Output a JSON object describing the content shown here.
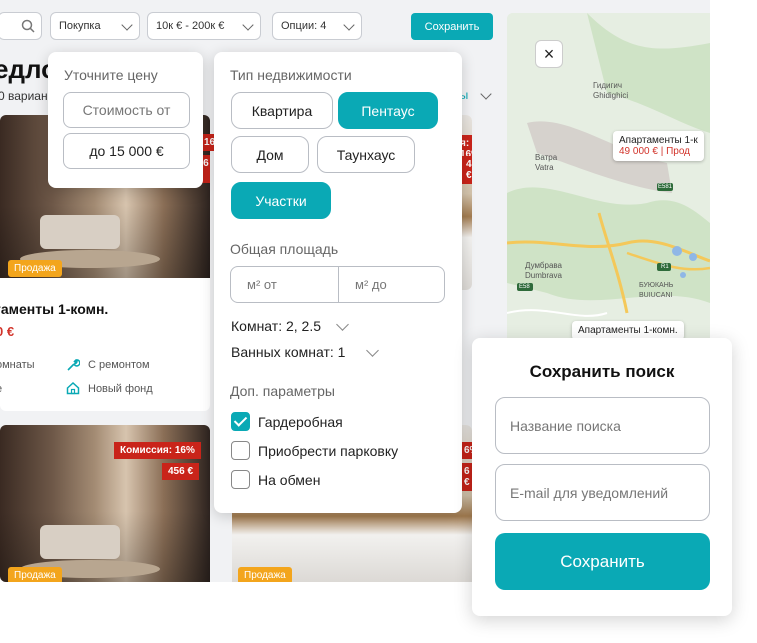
{
  "topbar": {
    "deal_type": "Покупка",
    "price_range": "10к € - 200к €",
    "options": "Опции: 4",
    "save_label": "Сохранить"
  },
  "listing": {
    "heading": "едложе",
    "count": "0 вариан",
    "sort_hint": "ны"
  },
  "cards": [
    {
      "badge": "Продажа",
      "commission": "Комиссия: 16%",
      "price_tag": "456 €",
      "title": "таменты 1-комн.",
      "price": "0 €",
      "features": [
        "омнаты",
        "С ремонтом",
        "е",
        "Новый фонд"
      ]
    },
    {
      "badge": "Продажа",
      "commission": "я: 16%",
      "price_tag": "456 €"
    },
    {
      "badge": "Продажа",
      "commission": "Комиссия: 16%",
      "price_tag": "456 €"
    },
    {
      "badge": "Продажа",
      "commission": "6%",
      "price_tag": "6 €"
    }
  ],
  "map": {
    "places": [
      "Гидигич\nGhidighici",
      "Ватра\nVatra",
      "Думбрава\nDumbrava",
      "БУЮКАНЬ\nBUIUCANI",
      "E581",
      "R1",
      "E58"
    ],
    "pin1_title": "Апартаменты 1-к",
    "pin1_price": "49 000 €",
    "pin1_status": "| Прод",
    "pin2_title": "Апартаменты 1-комн.",
    "close_icon": "×"
  },
  "price_filter": {
    "label": "Уточните цену",
    "from_placeholder": "Стоимость от",
    "to_value": "до 15 000 €"
  },
  "type_filter": {
    "label": "Тип недвижимости",
    "chips": [
      {
        "label": "Квартира",
        "selected": false
      },
      {
        "label": "Пентаус",
        "selected": true
      },
      {
        "label": "Дом",
        "selected": false
      },
      {
        "label": "Таунхаус",
        "selected": false
      },
      {
        "label": "Участки",
        "selected": true
      }
    ],
    "area_label": "Общая площадь",
    "area_from": "м² от",
    "area_to": "м² до",
    "rooms": "Комнат: 2, 2.5",
    "baths": "Ванных комнат: 1",
    "extra_label": "Доп. параметры",
    "checks": [
      {
        "label": "Гардеробная",
        "checked": true
      },
      {
        "label": "Приобрести парковку",
        "checked": false
      },
      {
        "label": "На обмен",
        "checked": false
      }
    ]
  },
  "save_search": {
    "title": "Сохранить поиск",
    "name_placeholder": "Название поиска",
    "email_placeholder": "E-mail для уведомлений",
    "button": "Сохранить"
  },
  "colors": {
    "accent": "#0aa9b5",
    "price_red": "#d2332a",
    "sale_badge": "#f3a51c"
  }
}
